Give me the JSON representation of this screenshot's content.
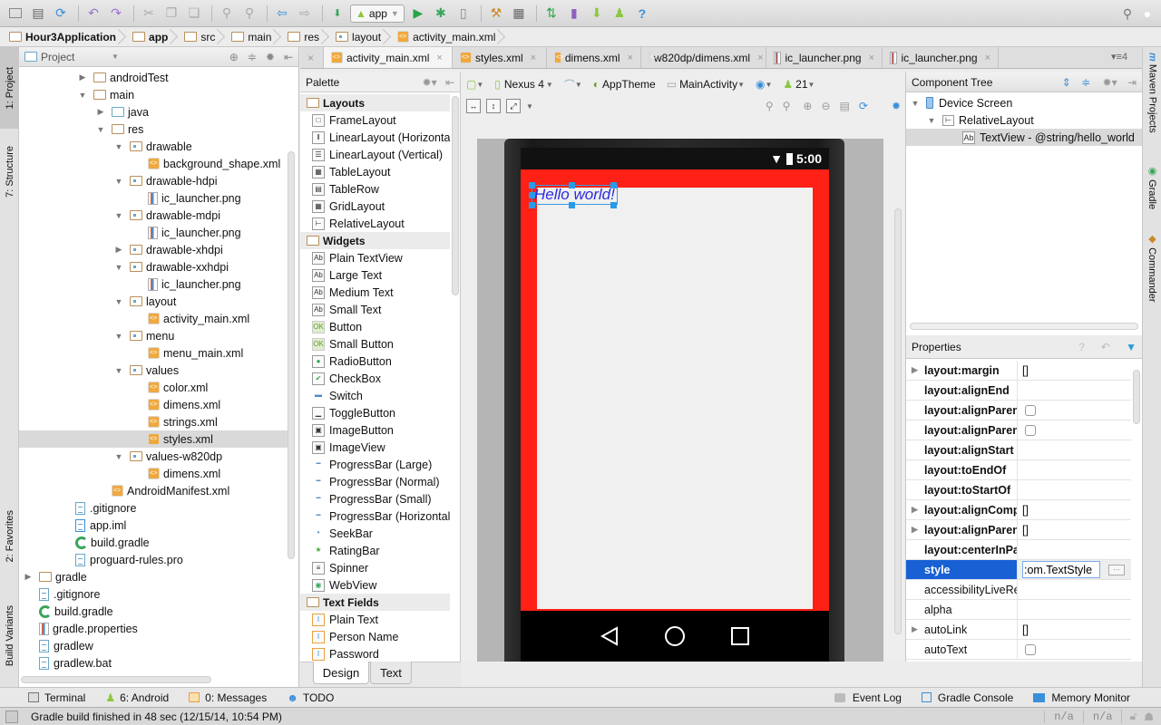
{
  "toolbar": {
    "run_config": "app",
    "icons": [
      "open-icon",
      "save-icon",
      "sync-icon",
      "undo-icon",
      "redo-icon",
      "cut-icon",
      "copy-icon",
      "paste-icon",
      "find-icon",
      "replace-icon",
      "back-icon",
      "forward-icon",
      "make-icon",
      "run-icon",
      "debug-icon",
      "attach-debugger-icon",
      "project-structure-icon",
      "sdk-manager-icon",
      "gradle-sync-icon",
      "avd-manager-icon",
      "android-device-monitor-icon",
      "help-icon",
      "search-everywhere-icon",
      "user-icon"
    ]
  },
  "breadcrumb": [
    "Hour3Application",
    "app",
    "src",
    "main",
    "res",
    "layout",
    "activity_main.xml"
  ],
  "left_strip": {
    "project": "1: Project",
    "structure": "7: Structure",
    "favorites": "2: Favorites",
    "build_variants": "Build Variants"
  },
  "right_strip": {
    "maven": "Maven Projects",
    "gradle": "Gradle",
    "commander": "Commander"
  },
  "project_panel": {
    "title": "Project",
    "tree": [
      {
        "label": "androidTest",
        "type": "folder",
        "expanded": false
      },
      {
        "label": "main",
        "type": "folder",
        "expanded": true
      },
      {
        "label": "java",
        "type": "folder-blue",
        "expanded": false
      },
      {
        "label": "res",
        "type": "folder-res",
        "expanded": true
      },
      {
        "label": "drawable",
        "type": "folder-dot",
        "expanded": true
      },
      {
        "label": "background_shape.xml",
        "type": "xml"
      },
      {
        "label": "drawable-hdpi",
        "type": "folder-dot",
        "expanded": true
      },
      {
        "label": "ic_launcher.png",
        "type": "png"
      },
      {
        "label": "drawable-mdpi",
        "type": "folder-dot",
        "expanded": true
      },
      {
        "label": "ic_launcher.png",
        "type": "png"
      },
      {
        "label": "drawable-xhdpi",
        "type": "folder-dot",
        "expanded": false
      },
      {
        "label": "drawable-xxhdpi",
        "type": "folder-dot",
        "expanded": true
      },
      {
        "label": "ic_launcher.png",
        "type": "png"
      },
      {
        "label": "layout",
        "type": "folder-dot",
        "expanded": true
      },
      {
        "label": "activity_main.xml",
        "type": "xml"
      },
      {
        "label": "menu",
        "type": "folder-dot",
        "expanded": true
      },
      {
        "label": "menu_main.xml",
        "type": "xml"
      },
      {
        "label": "values",
        "type": "folder-dot",
        "expanded": true
      },
      {
        "label": "color.xml",
        "type": "xml"
      },
      {
        "label": "dimens.xml",
        "type": "xml"
      },
      {
        "label": "strings.xml",
        "type": "xml"
      },
      {
        "label": "styles.xml",
        "type": "xml",
        "selected": true
      },
      {
        "label": "values-w820dp",
        "type": "folder-dot",
        "expanded": true
      },
      {
        "label": "dimens.xml",
        "type": "xml"
      },
      {
        "label": "AndroidManifest.xml",
        "type": "xml"
      },
      {
        "label": ".gitignore",
        "type": "text"
      },
      {
        "label": "app.iml",
        "type": "iml"
      },
      {
        "label": "build.gradle",
        "type": "gradle"
      },
      {
        "label": "proguard-rules.pro",
        "type": "text"
      },
      {
        "label": "gradle",
        "type": "folder",
        "expanded": false
      },
      {
        "label": ".gitignore",
        "type": "text"
      },
      {
        "label": "build.gradle",
        "type": "gradle"
      },
      {
        "label": "gradle.properties",
        "type": "props"
      },
      {
        "label": "gradlew",
        "type": "text"
      },
      {
        "label": "gradlew.bat",
        "type": "text"
      }
    ]
  },
  "editor_tabs": [
    {
      "label": "activity_main.xml",
      "icon": "xml",
      "active": true
    },
    {
      "label": "styles.xml",
      "icon": "xml"
    },
    {
      "label": "dimens.xml",
      "icon": "xml"
    },
    {
      "label": "w820dp/dimens.xml",
      "icon": "xml"
    },
    {
      "label": "ic_launcher.png",
      "icon": "png"
    },
    {
      "label": "ic_launcher.png",
      "icon": "png"
    }
  ],
  "editor_tabs_overflow": "4",
  "palette": {
    "title": "Palette",
    "sections": [
      {
        "name": "Layouts",
        "items": [
          {
            "label": "FrameLayout",
            "icon": "□"
          },
          {
            "label": "LinearLayout (Horizontal)",
            "icon": "‖"
          },
          {
            "label": "LinearLayout (Vertical)",
            "icon": "☰"
          },
          {
            "label": "TableLayout",
            "icon": "▦"
          },
          {
            "label": "TableRow",
            "icon": "▤"
          },
          {
            "label": "GridLayout",
            "icon": "▦"
          },
          {
            "label": "RelativeLayout",
            "icon": "⊢"
          }
        ]
      },
      {
        "name": "Widgets",
        "items": [
          {
            "label": "Plain TextView",
            "icon": "Ab"
          },
          {
            "label": "Large Text",
            "icon": "Ab"
          },
          {
            "label": "Medium Text",
            "icon": "Ab"
          },
          {
            "label": "Small Text",
            "icon": "Ab"
          },
          {
            "label": "Button",
            "icon": "OK"
          },
          {
            "label": "Small Button",
            "icon": "OK"
          },
          {
            "label": "RadioButton",
            "icon": "●"
          },
          {
            "label": "CheckBox",
            "icon": "✔"
          },
          {
            "label": "Switch",
            "icon": "▬"
          },
          {
            "label": "ToggleButton",
            "icon": "▁"
          },
          {
            "label": "ImageButton",
            "icon": "▣"
          },
          {
            "label": "ImageView",
            "icon": "▣"
          },
          {
            "label": "ProgressBar (Large)",
            "icon": "━"
          },
          {
            "label": "ProgressBar (Normal)",
            "icon": "━"
          },
          {
            "label": "ProgressBar (Small)",
            "icon": "━"
          },
          {
            "label": "ProgressBar (Horizontal)",
            "icon": "━"
          },
          {
            "label": "SeekBar",
            "icon": "•"
          },
          {
            "label": "RatingBar",
            "icon": "★"
          },
          {
            "label": "Spinner",
            "icon": "≡"
          },
          {
            "label": "WebView",
            "icon": "◉"
          }
        ]
      },
      {
        "name": "Text Fields",
        "items": [
          {
            "label": "Plain Text",
            "icon": "I"
          },
          {
            "label": "Person Name",
            "icon": "I"
          },
          {
            "label": "Password",
            "icon": "I"
          }
        ]
      }
    ]
  },
  "design_tabs": [
    {
      "label": "Design",
      "active": true
    },
    {
      "label": "Text"
    }
  ],
  "canvas_toolbar": {
    "device": "Nexus 4",
    "theme": "AppTheme",
    "activity": "MainActivity",
    "api": "21"
  },
  "device_preview": {
    "clock": "5:00",
    "textview_text": "Hello world!",
    "background_color": "#ff2016",
    "inner_color": "#f0f0f0",
    "text_color": "#2b2be0"
  },
  "component_tree": {
    "title": "Component Tree",
    "items": [
      {
        "label": "Device Screen",
        "depth": 0
      },
      {
        "label": "RelativeLayout",
        "depth": 1
      },
      {
        "label": "TextView - @string/hello_world",
        "depth": 2,
        "selected": true
      }
    ]
  },
  "properties": {
    "title": "Properties",
    "rows": [
      {
        "name": "layout:margin",
        "value": "[]",
        "expandable": true,
        "bold": true
      },
      {
        "name": "layout:alignEnd",
        "value": "",
        "bold": true
      },
      {
        "name": "layout:alignParentEnd",
        "value": "checkbox",
        "bold": true
      },
      {
        "name": "layout:alignParentStart",
        "value": "checkbox",
        "bold": true
      },
      {
        "name": "layout:alignStart",
        "value": "",
        "bold": true
      },
      {
        "name": "layout:toEndOf",
        "value": "",
        "bold": true
      },
      {
        "name": "layout:toStartOf",
        "value": "",
        "bold": true
      },
      {
        "name": "layout:alignComponent",
        "value": "[]",
        "expandable": true,
        "bold": true
      },
      {
        "name": "layout:alignParent",
        "value": "[]",
        "expandable": true,
        "bold": true
      },
      {
        "name": "layout:centerInParent",
        "value": "",
        "bold": true
      },
      {
        "name": "style",
        "value": ":om.TextStyle",
        "selected": true,
        "editing": true,
        "bold": true
      },
      {
        "name": "accessibilityLiveRegion",
        "value": ""
      },
      {
        "name": "alpha",
        "value": ""
      },
      {
        "name": "autoLink",
        "value": "[]",
        "expandable": true
      },
      {
        "name": "autoText",
        "value": "checkbox"
      }
    ]
  },
  "bottom_tools": {
    "left": [
      {
        "label": "Terminal",
        "icon": "terminal-icon"
      },
      {
        "label": "6: Android",
        "icon": "android-icon"
      },
      {
        "label": "0: Messages",
        "icon": "messages-icon"
      },
      {
        "label": "TODO",
        "icon": "todo-icon"
      }
    ],
    "right": [
      {
        "label": "Event Log",
        "icon": "event-log-icon"
      },
      {
        "label": "Gradle Console",
        "icon": "gradle-console-icon"
      },
      {
        "label": "Memory Monitor",
        "icon": "memory-monitor-icon"
      }
    ]
  },
  "status": {
    "message": "Gradle build finished in 48 sec (12/15/14, 10:54 PM)",
    "cell1": "n/a",
    "cell2": "n/a"
  }
}
